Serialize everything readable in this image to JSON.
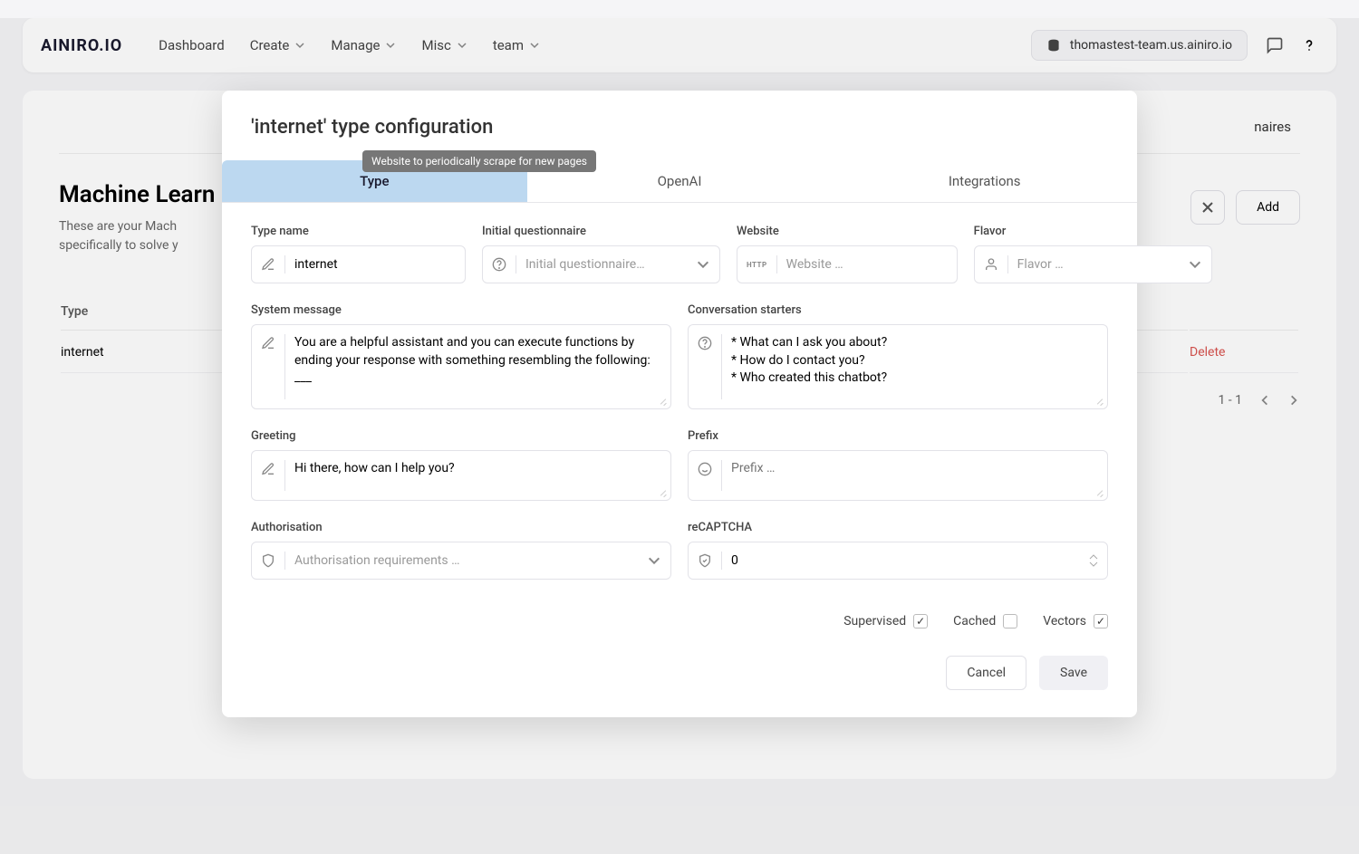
{
  "logo_text": "AINIRO.IO",
  "nav": {
    "dashboard": "Dashboard",
    "create": "Create",
    "manage": "Manage",
    "misc": "Misc",
    "team": "team"
  },
  "team_chip": "thomastest-team.us.ainiro.io",
  "page": {
    "partial_tab": "naires",
    "title_prefix": "Machine Learn",
    "desc_line1": "These are your Mach",
    "desc_line2": "specifically to solve y",
    "add_button": "Add",
    "table": {
      "type_header": "Type",
      "row_type": "internet",
      "delete": "Delete"
    },
    "pagination": {
      "range": "1 - 1"
    }
  },
  "modal": {
    "title": "'internet' type configuration",
    "tabs": {
      "type": "Type",
      "openai": "OpenAI",
      "integrations": "Integrations"
    },
    "fields": {
      "type_name": {
        "label": "Type name",
        "value": "internet"
      },
      "initial_questionnaire": {
        "label": "Initial questionnaire",
        "placeholder": "Initial questionnaire…"
      },
      "website": {
        "label": "Website",
        "placeholder": "Website …"
      },
      "flavor": {
        "label": "Flavor",
        "placeholder": "Flavor …"
      },
      "system_message": {
        "label": "System message",
        "value": "You are a helpful assistant and you can execute functions by ending your response with something resembling the following:\n___"
      },
      "conversation_starters": {
        "label": "Conversation starters",
        "value": "* What can I ask you about?\n* How do I contact you?\n* Who created this chatbot?"
      },
      "greeting": {
        "label": "Greeting",
        "value": "Hi there, how can I help you?"
      },
      "prefix": {
        "label": "Prefix",
        "placeholder": "Prefix …"
      },
      "authorisation": {
        "label": "Authorisation",
        "placeholder": "Authorisation requirements …"
      },
      "recaptcha": {
        "label": "reCAPTCHA",
        "value": "0"
      }
    },
    "checkboxes": {
      "supervised": "Supervised",
      "cached": "Cached",
      "vectors": "Vectors"
    },
    "actions": {
      "cancel": "Cancel",
      "save": "Save"
    },
    "tooltip": "Website to periodically scrape for new pages"
  }
}
